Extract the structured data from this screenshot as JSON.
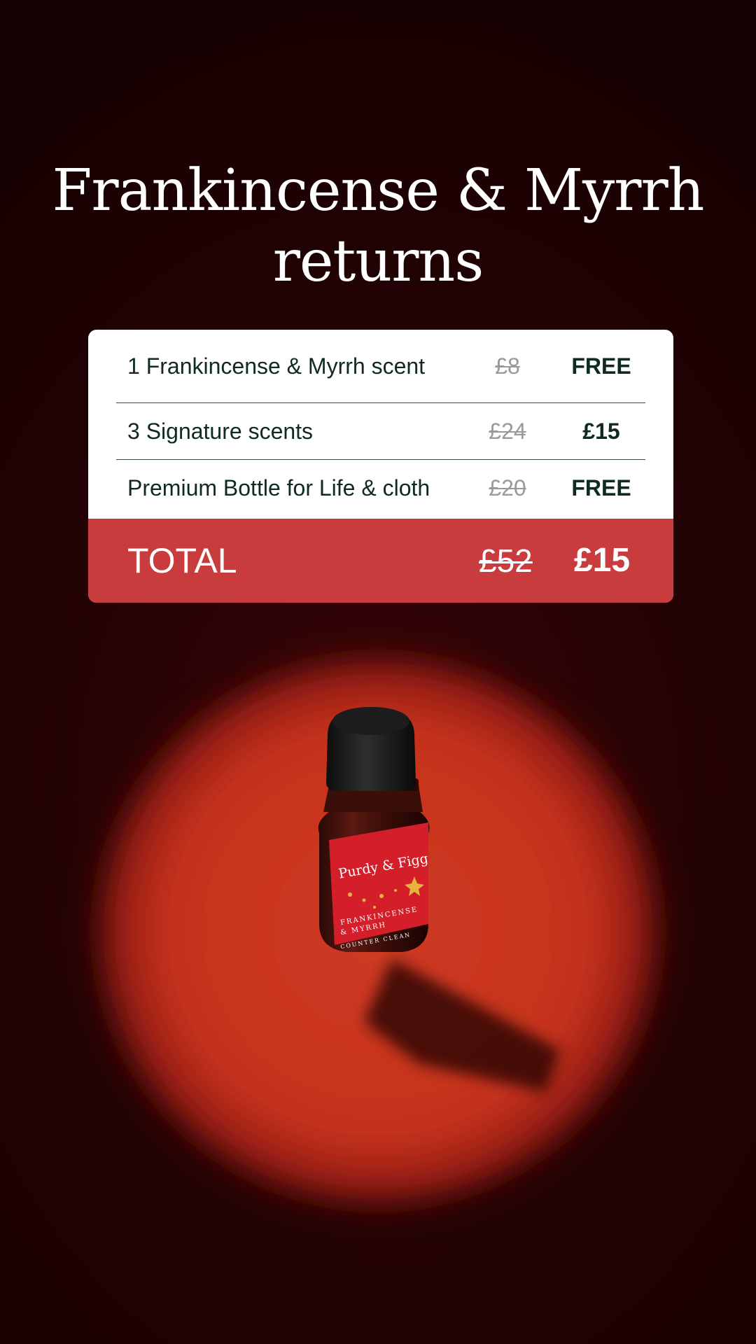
{
  "headline": {
    "line1": "Frankincense & Myrrh",
    "line2": "returns"
  },
  "offer": {
    "items": [
      {
        "label": "1 Frankincense & Myrrh scent",
        "was": "£8",
        "now": "FREE"
      },
      {
        "label": "3 Signature scents",
        "was": "£24",
        "now": "£15"
      },
      {
        "label": "Premium Bottle for Life & cloth",
        "was": "£20",
        "now": "FREE"
      }
    ],
    "total": {
      "label": "TOTAL",
      "was": "£52",
      "now": "£15"
    }
  },
  "product": {
    "brand": "Purdy & Figg",
    "name_line1": "FRANKINCENSE",
    "name_line2": "& MYRRH",
    "type": "COUNTER CLEAN"
  },
  "colors": {
    "background": "#230304",
    "spotlight": "#c8341f",
    "card": "#ffffff",
    "total_bar": "#c93c3e",
    "text_dark": "#0f2a24",
    "strikethrough": "#9a9a9a",
    "label": "#d41e2a"
  }
}
